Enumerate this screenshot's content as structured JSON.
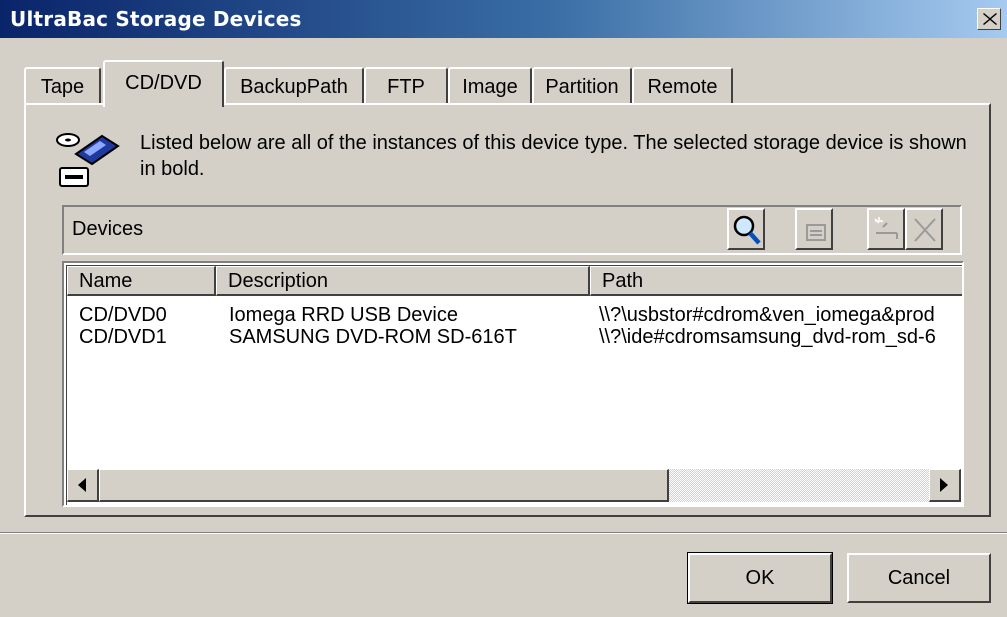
{
  "window": {
    "title": "UltraBac Storage Devices"
  },
  "tabs": [
    {
      "label": "Tape"
    },
    {
      "label": "CD/DVD",
      "active": true
    },
    {
      "label": "BackupPath"
    },
    {
      "label": "FTP"
    },
    {
      "label": "Image"
    },
    {
      "label": "Partition"
    },
    {
      "label": "Remote"
    }
  ],
  "info": {
    "icon": "storage-device-icon",
    "text": "Listed below are all of the instances of this device type. The selected storage device is shown in bold."
  },
  "devices_bar": {
    "label": "Devices",
    "toolbar": [
      {
        "icon": "search-icon",
        "enabled": true
      },
      {
        "icon": "properties-icon",
        "enabled": false
      },
      {
        "icon": "new-device-icon",
        "enabled": false
      },
      {
        "icon": "delete-icon",
        "enabled": false
      }
    ]
  },
  "list": {
    "columns": [
      "Name",
      "Description",
      "Path"
    ],
    "rows": [
      {
        "name": "CD/DVD0",
        "description": "Iomega RRD USB Device",
        "path": "\\\\?\\usbstor#cdrom&ven_iomega&prod"
      },
      {
        "name": "CD/DVD1",
        "description": "SAMSUNG DVD-ROM SD-616T",
        "path": "\\\\?\\ide#cdromsamsung_dvd-rom_sd-6"
      }
    ]
  },
  "buttons": {
    "ok": "OK",
    "cancel": "Cancel"
  },
  "colors": {
    "titlebar_start": "#0a246a",
    "titlebar_end": "#a6caf0",
    "face": "#d4d0c8"
  }
}
